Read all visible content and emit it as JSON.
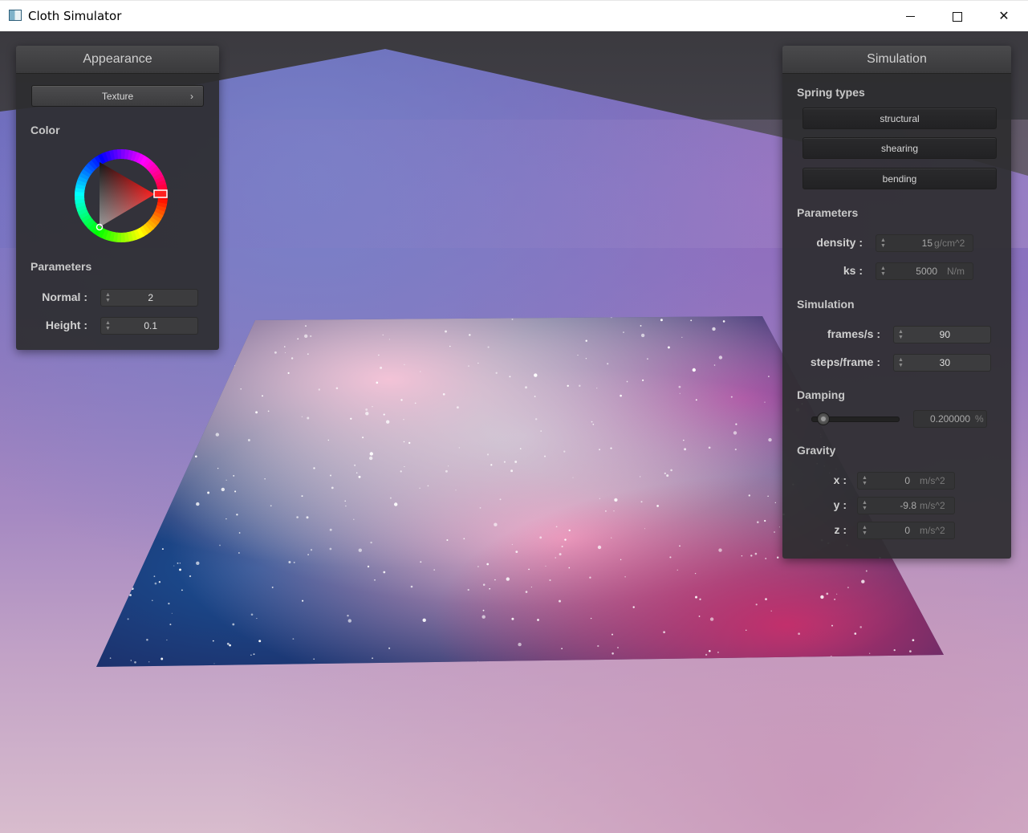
{
  "window": {
    "title": "Cloth Simulator",
    "minimize_icon": "minimize-icon",
    "maximize_icon": "maximize-icon",
    "close_glyph": "✕"
  },
  "appearance": {
    "title": "Appearance",
    "shader_button": "Texture",
    "shader_chevron": "›",
    "color_label": "Color",
    "color_value": "#ff0000",
    "parameters_label": "Parameters",
    "normal_label": "Normal :",
    "normal_value": "2",
    "height_label": "Height :",
    "height_value": "0.1"
  },
  "simulation": {
    "title": "Simulation",
    "spring_types_label": "Spring types",
    "spring_buttons": [
      "structural",
      "shearing",
      "bending"
    ],
    "parameters_label": "Parameters",
    "density_label": "density :",
    "density_value": "15",
    "density_unit": "g/cm^2",
    "ks_label": "ks :",
    "ks_value": "5000",
    "ks_unit": "N/m",
    "simulation_label": "Simulation",
    "fps_label": "frames/s :",
    "fps_value": "90",
    "steps_label": "steps/frame :",
    "steps_value": "30",
    "damping_label": "Damping",
    "damping_value": "0.200000",
    "damping_unit": "%",
    "damping_slider_fraction": 0.2,
    "gravity_label": "Gravity",
    "gravity": [
      {
        "label": "x :",
        "value": "0",
        "unit": "m/s^2"
      },
      {
        "label": "y :",
        "value": "-9.8",
        "unit": "m/s^2"
      },
      {
        "label": "z :",
        "value": "0",
        "unit": "m/s^2"
      }
    ]
  }
}
